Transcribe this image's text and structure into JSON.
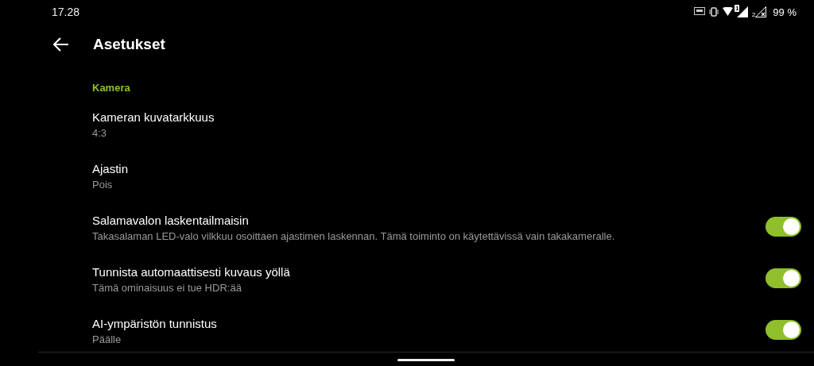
{
  "status_bar": {
    "time": "17.28",
    "sim_badge": "1",
    "sim2_label": "2",
    "battery": "99 %"
  },
  "header": {
    "title": "Asetukset"
  },
  "section": {
    "title": "Kamera"
  },
  "items": [
    {
      "kind": "value",
      "title": "Kameran kuvatarkkuus",
      "subtitle": "4:3"
    },
    {
      "kind": "value",
      "title": "Ajastin",
      "subtitle": "Pois"
    },
    {
      "kind": "toggle",
      "title": "Salamavalon laskentailmaisin",
      "subtitle": "Takasalaman LED-valo vilkkuu osoittaen ajastimen laskennan. Tämä toiminto on käytettävissä vain takakameralle.",
      "on": true
    },
    {
      "kind": "toggle",
      "title": "Tunnista automaattisesti kuvaus yöllä",
      "subtitle": "Tämä ominaisuus ei tue HDR:ää",
      "on": true
    },
    {
      "kind": "toggle",
      "title": "AI-ympäristön tunnistus",
      "subtitle": "Päälle",
      "on": true
    }
  ]
}
